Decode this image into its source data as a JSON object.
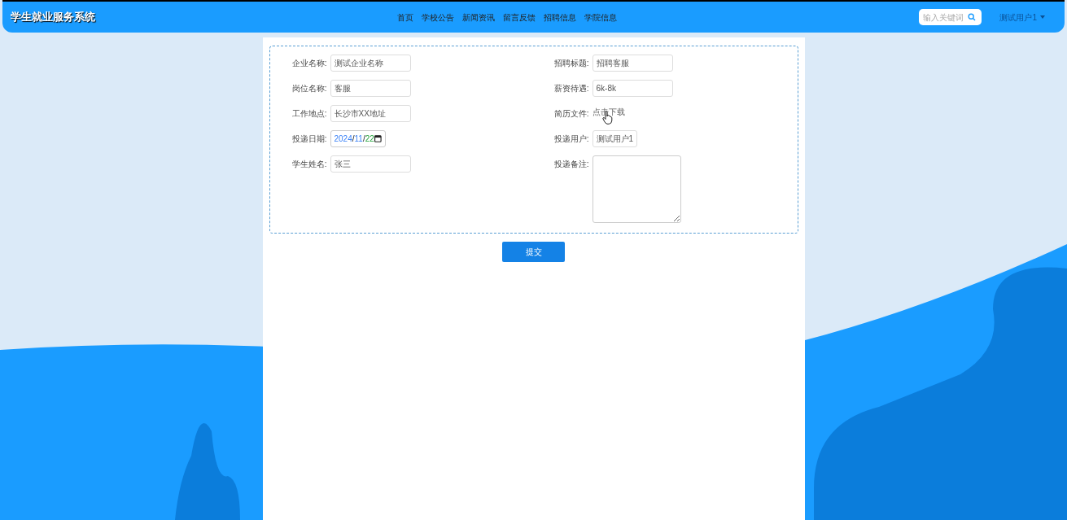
{
  "brand": "学生就业服务系统",
  "nav": [
    {
      "label": "首页"
    },
    {
      "label": "学校公告"
    },
    {
      "label": "新闻资讯"
    },
    {
      "label": "留言反馈"
    },
    {
      "label": "招聘信息"
    },
    {
      "label": "学院信息"
    }
  ],
  "search": {
    "placeholder": "输入关键词"
  },
  "user": {
    "name": "测试用户1"
  },
  "form": {
    "left": [
      {
        "label": "企业名称:",
        "kind": "text",
        "value": "测试企业名称"
      },
      {
        "label": "岗位名称:",
        "kind": "text",
        "value": "客服"
      },
      {
        "label": "工作地点:",
        "kind": "text",
        "value": "长沙市XX地址"
      },
      {
        "label": "投递日期:",
        "kind": "date",
        "value": "2024/11/22"
      },
      {
        "label": "学生姓名:",
        "kind": "text",
        "value": "张三"
      }
    ],
    "right": [
      {
        "label": "招聘标题:",
        "kind": "text",
        "value": "招聘客服"
      },
      {
        "label": "薪资待遇:",
        "kind": "text",
        "value": "6k-8k"
      },
      {
        "label": "简历文件:",
        "kind": "link",
        "value": "点击下载"
      },
      {
        "label": "投递用户:",
        "kind": "short",
        "value": "测试用户1"
      },
      {
        "label": "投递备注:",
        "kind": "textarea"
      }
    ]
  },
  "submit": "提交"
}
